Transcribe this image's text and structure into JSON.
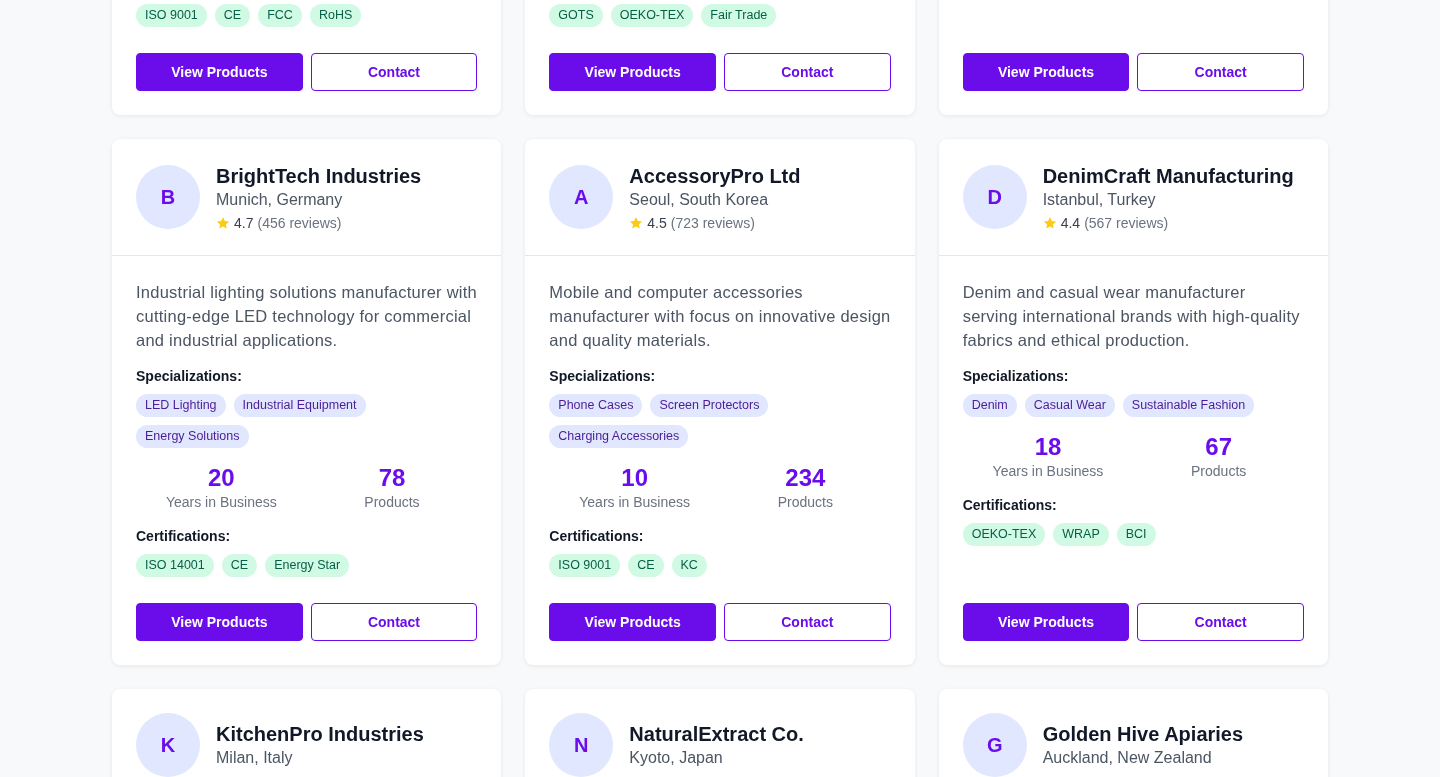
{
  "suppliers": [
    {
      "certifications": [
        "ISO 9001",
        "CE",
        "FCC",
        "RoHS"
      ],
      "actions": [
        "View Products",
        "Contact"
      ]
    },
    {
      "certifications": [
        "GOTS",
        "OEKO-TEX",
        "Fair Trade"
      ],
      "actions": [
        "View Products",
        "Contact"
      ]
    },
    {
      "actions": [
        "View Products",
        "Contact"
      ]
    },
    {
      "initial": "B",
      "name": "BrightTech Industries",
      "location": "Munich, Germany",
      "rating": "4.7",
      "reviews": "(456 reviews)",
      "description": "Industrial lighting solutions manufacturer with cutting-edge LED technology for commercial and industrial applications.",
      "specializations_label": "Specializations:",
      "specializations": [
        "LED Lighting",
        "Industrial Equipment",
        "Energy Solutions"
      ],
      "stats": [
        {
          "value": "20",
          "label": "Years in Business"
        },
        {
          "value": "78",
          "label": "Products"
        }
      ],
      "certifications_label": "Certifications:",
      "certifications": [
        "ISO 14001",
        "CE",
        "Energy Star"
      ],
      "actions": [
        "View Products",
        "Contact"
      ]
    },
    {
      "initial": "A",
      "name": "AccessoryPro Ltd",
      "location": "Seoul, South Korea",
      "rating": "4.5",
      "reviews": "(723 reviews)",
      "description": "Mobile and computer accessories manufacturer with focus on innovative design and quality materials.",
      "specializations_label": "Specializations:",
      "specializations": [
        "Phone Cases",
        "Screen Protectors",
        "Charging Accessories"
      ],
      "stats": [
        {
          "value": "10",
          "label": "Years in Business"
        },
        {
          "value": "234",
          "label": "Products"
        }
      ],
      "certifications_label": "Certifications:",
      "certifications": [
        "ISO 9001",
        "CE",
        "KC"
      ],
      "actions": [
        "View Products",
        "Contact"
      ]
    },
    {
      "initial": "D",
      "name": "DenimCraft Manufacturing",
      "location": "Istanbul, Turkey",
      "rating": "4.4",
      "reviews": "(567 reviews)",
      "description": "Denim and casual wear manufacturer serving international brands with high-quality fabrics and ethical production.",
      "specializations_label": "Specializations:",
      "specializations": [
        "Denim",
        "Casual Wear",
        "Sustainable Fashion"
      ],
      "stats": [
        {
          "value": "18",
          "label": "Years in Business"
        },
        {
          "value": "67",
          "label": "Products"
        }
      ],
      "certifications_label": "Certifications:",
      "certifications": [
        "OEKO-TEX",
        "WRAP",
        "BCI"
      ],
      "actions": [
        "View Products",
        "Contact"
      ]
    },
    {
      "initial": "K",
      "name": "KitchenPro Industries",
      "location": "Milan, Italy"
    },
    {
      "initial": "N",
      "name": "NaturalExtract Co.",
      "location": "Kyoto, Japan"
    },
    {
      "initial": "G",
      "name": "Golden Hive Apiaries",
      "location": "Auckland, New Zealand"
    }
  ]
}
